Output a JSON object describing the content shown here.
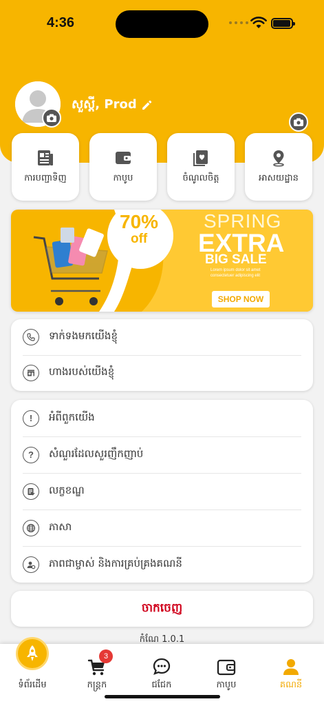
{
  "status": {
    "time": "4:36"
  },
  "profile": {
    "greeting": "សួស្តី, Prod"
  },
  "quick_actions": [
    {
      "label": "ការបញ្ជាទិញ",
      "icon": "document-icon"
    },
    {
      "label": "កាបូប",
      "icon": "wallet-icon"
    },
    {
      "label": "ចំណូលចិត្ត",
      "icon": "favorite-icon"
    },
    {
      "label": "អាសយដ្ឋាន",
      "icon": "location-pin-icon"
    }
  ],
  "banner": {
    "discount_percent": "70%",
    "discount_off": "off",
    "line1": "SPRING",
    "line2": "EXTRA",
    "line3": "BIG SALE",
    "small1": "Lorem ipsum dolor sit amet",
    "small2": "consectetuer adipiscing elit",
    "cta": "SHOP NOW"
  },
  "contact_section": [
    {
      "label": "ទាក់ទងមកយើងខ្ញុំ",
      "icon": "phone-icon"
    },
    {
      "label": "ហាងរបស់យើងខ្ញុំ",
      "icon": "store-icon"
    }
  ],
  "info_section": [
    {
      "label": "អំពីពួកយើង",
      "icon": "info-icon"
    },
    {
      "label": "សំណួរដែលសួរញឹកញាប់",
      "icon": "question-icon"
    },
    {
      "label": "លក្ខខណ្ឌ",
      "icon": "terms-icon"
    },
    {
      "label": "ភាសា",
      "icon": "globe-icon"
    },
    {
      "label": "ភាពជាម្ចាស់ និងការគ្រប់គ្រងគណនី",
      "icon": "account-manage-icon"
    }
  ],
  "logout_label": "ចាកចេញ",
  "version": "កំណែ 1.0.1",
  "tabs": [
    {
      "label": "ទំព័រដើម",
      "icon": "rocket-icon"
    },
    {
      "label": "កន្ត្រក",
      "icon": "cart-icon",
      "badge": "3"
    },
    {
      "label": "ជជែក",
      "icon": "chat-icon"
    },
    {
      "label": "កាបូប",
      "icon": "wallet-icon"
    },
    {
      "label": "គណនី",
      "icon": "account-icon",
      "active": true
    }
  ],
  "colors": {
    "brand": "#f7b500",
    "logout": "#d0011b",
    "active_tab": "#f2a900",
    "badge": "#e53935"
  }
}
